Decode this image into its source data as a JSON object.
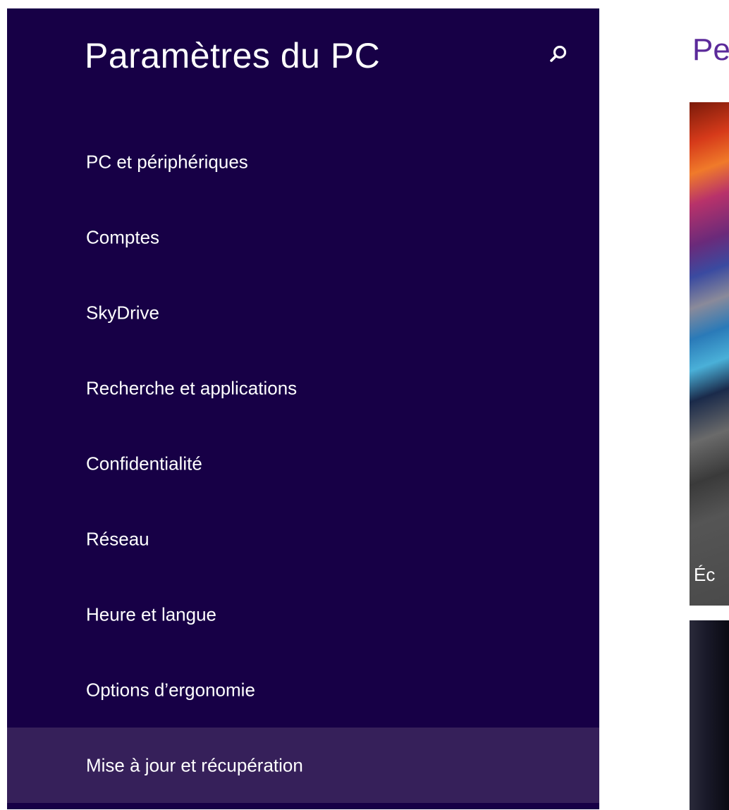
{
  "sidebar": {
    "title": "Paramètres du PC",
    "search_icon": "search-icon",
    "items": [
      {
        "label": "PC et périphériques"
      },
      {
        "label": "Comptes"
      },
      {
        "label": "SkyDrive"
      },
      {
        "label": "Recherche et applications"
      },
      {
        "label": "Confidentialité"
      },
      {
        "label": "Réseau"
      },
      {
        "label": "Heure et langue"
      },
      {
        "label": "Options d’ergonomie"
      },
      {
        "label": "Mise à jour et récupération"
      }
    ],
    "selected_index": 8
  },
  "content": {
    "title": "Pe",
    "tile1_caption": "Éc"
  },
  "colors": {
    "sidebar_bg": "#170046",
    "selected_bg": "#36205a",
    "accent": "#5b2a9a"
  }
}
